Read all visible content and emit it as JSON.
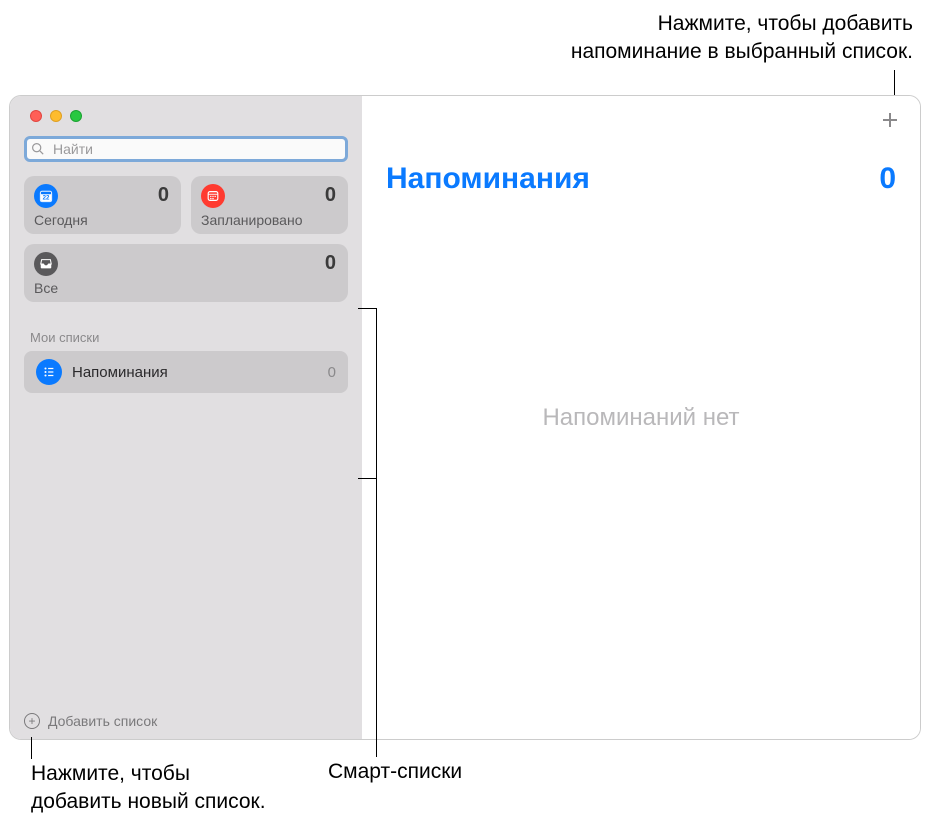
{
  "callouts": {
    "top_line1": "Нажмите, чтобы добавить",
    "top_line2": "напоминание в выбранный список.",
    "bottom_left_line1": "Нажмите, чтобы",
    "bottom_left_line2": "добавить новый список.",
    "bottom_mid": "Смарт-списки"
  },
  "search": {
    "placeholder": "Найти"
  },
  "smart_lists": {
    "today": {
      "label": "Сегодня",
      "count": "0"
    },
    "scheduled": {
      "label": "Запланировано",
      "count": "0"
    },
    "all": {
      "label": "Все",
      "count": "0"
    }
  },
  "my_lists": {
    "header": "Мои списки",
    "items": [
      {
        "name": "Напоминания",
        "count": "0"
      }
    ]
  },
  "add_list_label": "Добавить список",
  "main": {
    "title": "Напоминания",
    "count": "0",
    "empty": "Напоминаний нет"
  }
}
